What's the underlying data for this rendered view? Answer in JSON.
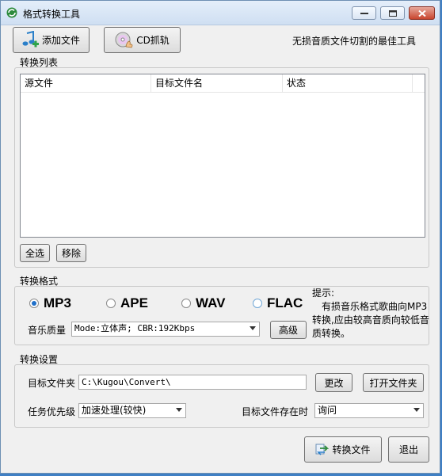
{
  "window": {
    "title": "格式转换工具"
  },
  "toolbar": {
    "add_file_label": "添加文件",
    "cd_rip_label": "CD抓轨",
    "slogan": "无损音质文件切割的最佳工具"
  },
  "convert_list": {
    "group_label": "转换列表",
    "columns": [
      "源文件",
      "目标文件名",
      "状态"
    ],
    "rows": [],
    "select_all_label": "全选",
    "remove_label": "移除"
  },
  "format": {
    "group_label": "转换格式",
    "options": [
      "MP3",
      "APE",
      "WAV",
      "FLAC"
    ],
    "selected": "MP3",
    "quality_label": "音乐质量",
    "quality_value": "Mode:立体声; CBR:192Kbps",
    "advanced_label": "高级",
    "tip_title": "提示:",
    "tip_text": "有损音乐格式歌曲向MP3转换,应由较高音质向较低音质转换。"
  },
  "settings": {
    "group_label": "转换设置",
    "target_folder_label": "目标文件夹",
    "target_folder_value": "C:\\Kugou\\Convert\\",
    "change_label": "更改",
    "open_folder_label": "打开文件夹",
    "priority_label": "任务优先级",
    "priority_value": "加速处理(较快)",
    "exists_label": "目标文件存在时",
    "exists_value": "询问"
  },
  "actions": {
    "convert_label": "转换文件",
    "exit_label": "退出"
  }
}
